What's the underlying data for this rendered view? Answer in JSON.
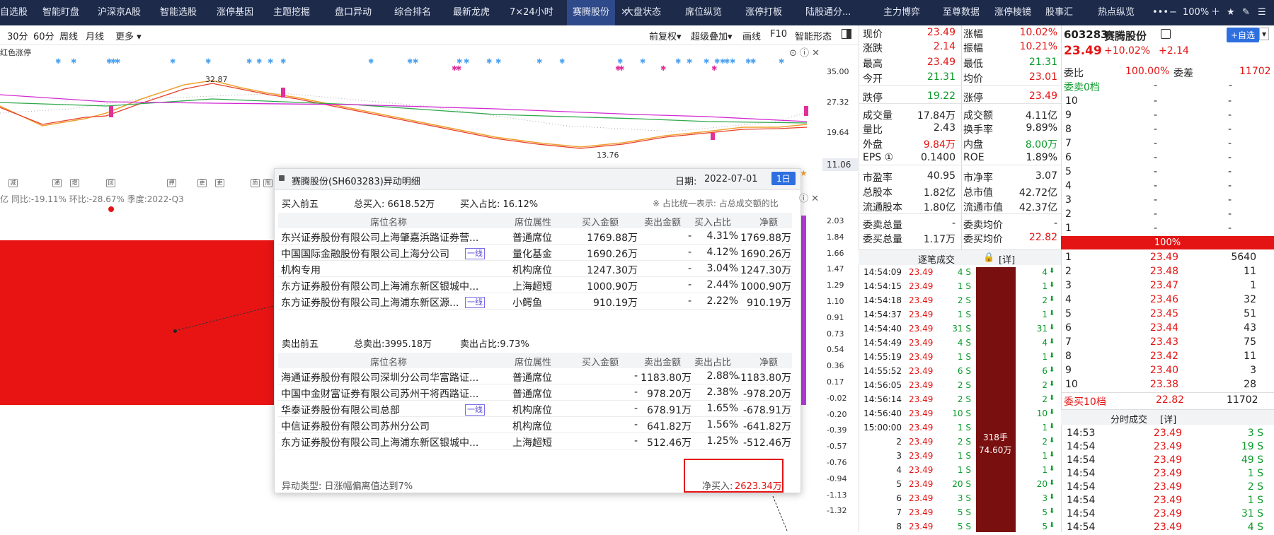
{
  "top_tabs": [
    "自选股",
    "智能盯盘",
    "沪深京A股",
    "智能选股",
    "涨停基因",
    "主题挖掘",
    "盘口异动",
    "综合排名",
    "最新龙虎",
    "7×24小时",
    "赛腾股份",
    "大盘状态",
    "席位纵览",
    "涨停打板",
    "陆股通分...",
    "主力博弈",
    "至尊数据",
    "涨停棱镜",
    "股事汇",
    "热点纵览"
  ],
  "zoom": "100%",
  "toolbar_left": [
    "30分",
    "60分",
    "周线",
    "月线",
    "更多"
  ],
  "toolbar_right": [
    "前复权",
    "超级叠加",
    "画线",
    "F10",
    "智能形态"
  ],
  "chart": {
    "legend_label": "红色涨停",
    "axis_labels": [
      "35.00",
      "27.32",
      "19.64",
      "11.06"
    ],
    "high_label": "32.87",
    "low_label": "13.76",
    "sub_axis": [
      "2.03",
      "1.84",
      "1.66",
      "1.47",
      "1.29",
      "1.10",
      "0.91",
      "0.73",
      "0.54",
      "0.36",
      "0.17",
      "-0.02",
      "-0.20",
      "-0.39",
      "-0.57",
      "-0.76",
      "-0.94",
      "-1.13",
      "-1.32"
    ],
    "finance_bar": "亿  同比:-19.11%  环比:-28.67%  季度:2022-Q3",
    "markers": [
      "减",
      "通",
      "增",
      "回",
      "押",
      "更",
      "更",
      "质",
      "周"
    ]
  },
  "popup": {
    "title": "赛腾股份(SH603283)异动明细",
    "date_label": "日期:",
    "date": "2022-07-01",
    "day_button": "1日",
    "buy": {
      "heading": "买入前五",
      "total": "总买入: 6618.52万",
      "ratio": "买入占比: 16.12%"
    },
    "note": "※ 占比统一表示: 占总成交额的比",
    "columns": [
      "席位名称",
      "席位属性",
      "买入金额",
      "卖出金额",
      "买入占比",
      "净额"
    ],
    "sell_columns": [
      "席位名称",
      "席位属性",
      "买入金额",
      "卖出金额",
      "卖出占比",
      "净额"
    ],
    "buy_rows": [
      {
        "name": "东兴证券股份有限公司上海肇嘉浜路证券营...",
        "tag": "",
        "attr": "普通席位",
        "buy": "1769.88万",
        "sell": "-",
        "ratio": "4.31%",
        "net": "1769.88万"
      },
      {
        "name": "中国国际金融股份有限公司上海分公司",
        "tag": "一线",
        "attr": "量化基金",
        "buy": "1690.26万",
        "sell": "-",
        "ratio": "4.12%",
        "net": "1690.26万"
      },
      {
        "name": "机构专用",
        "tag": "",
        "attr": "机构席位",
        "buy": "1247.30万",
        "sell": "-",
        "ratio": "3.04%",
        "net": "1247.30万"
      },
      {
        "name": "东方证券股份有限公司上海浦东新区银城中...",
        "tag": "",
        "attr": "上海超短",
        "buy": "1000.90万",
        "sell": "-",
        "ratio": "2.44%",
        "net": "1000.90万"
      },
      {
        "name": "东方证券股份有限公司上海浦东新区源...",
        "tag": "一线",
        "attr": "小鳄鱼",
        "buy": "910.19万",
        "sell": "-",
        "ratio": "2.22%",
        "net": "910.19万"
      }
    ],
    "sell": {
      "heading": "卖出前五",
      "total": "总卖出:3995.18万",
      "ratio": "卖出占比:9.73%"
    },
    "sell_rows": [
      {
        "name": "海通证券股份有限公司深圳分公司华富路证...",
        "tag": "",
        "attr": "普通席位",
        "buy": "-",
        "sell": "1183.80万",
        "ratio": "2.88%",
        "net": "-1183.80万"
      },
      {
        "name": "中国中金财富证券有限公司苏州干将西路证...",
        "tag": "",
        "attr": "普通席位",
        "buy": "-",
        "sell": "978.20万",
        "ratio": "2.38%",
        "net": "-978.20万"
      },
      {
        "name": "华泰证券股份有限公司总部",
        "tag": "一线",
        "attr": "机构席位",
        "buy": "-",
        "sell": "678.91万",
        "ratio": "1.65%",
        "net": "-678.91万"
      },
      {
        "name": "中信证券股份有限公司苏州分公司",
        "tag": "",
        "attr": "机构席位",
        "buy": "-",
        "sell": "641.82万",
        "ratio": "1.56%",
        "net": "-641.82万"
      },
      {
        "name": "东方证券股份有限公司上海浦东新区银城中...",
        "tag": "",
        "attr": "上海超短",
        "buy": "-",
        "sell": "512.46万",
        "ratio": "1.25%",
        "net": "-512.46万"
      }
    ],
    "type_label": "异动类型: 日涨幅偏离值达到7%",
    "net_label": "净买入:",
    "net_value": "2623.34万"
  },
  "quote": {
    "rows": [
      [
        "现价",
        "23.49",
        "red",
        "涨幅",
        "10.02%",
        "red"
      ],
      [
        "涨跌",
        "2.14",
        "red",
        "振幅",
        "10.21%",
        "red"
      ],
      [
        "最高",
        "23.49",
        "red",
        "最低",
        "21.31",
        "green"
      ],
      [
        "今开",
        "21.31",
        "green",
        "均价",
        "23.01",
        "red"
      ],
      [
        "跌停",
        "19.22",
        "green",
        "涨停",
        "23.49",
        "red"
      ],
      [
        "成交量",
        "17.84万",
        "blk",
        "成交额",
        "4.11亿",
        "blk"
      ],
      [
        "量比",
        "2.43",
        "blk",
        "换手率",
        "9.89%",
        "blk"
      ],
      [
        "外盘",
        "9.84万",
        "red",
        "内盘",
        "8.00万",
        "green"
      ],
      [
        "EPS ①",
        "0.1400",
        "blk",
        "ROE",
        "1.89%",
        "blk"
      ],
      [
        "市盈率",
        "40.95",
        "blk",
        "市净率",
        "3.07",
        "blk"
      ],
      [
        "总股本",
        "1.82亿",
        "blk",
        "总市值",
        "42.72亿",
        "blk"
      ],
      [
        "流通股本",
        "1.80亿",
        "blk",
        "流通市值",
        "42.37亿",
        "blk"
      ],
      [
        "委卖总量",
        "-",
        "blk",
        "委卖均价",
        "-",
        "blk"
      ],
      [
        "委买总量",
        "1.17万",
        "blk",
        "委买均价",
        "22.82",
        "red"
      ]
    ]
  },
  "ticks": {
    "header": "逐笔成交",
    "detail": "[详]",
    "rows": [
      [
        "14:54:09",
        "23.49",
        "4 S",
        "4"
      ],
      [
        "14:54:15",
        "23.49",
        "1 S",
        "1"
      ],
      [
        "14:54:18",
        "23.49",
        "2 S",
        "2"
      ],
      [
        "14:54:37",
        "23.49",
        "1 S",
        "1"
      ],
      [
        "14:54:40",
        "23.49",
        "31 S",
        "31"
      ],
      [
        "14:54:49",
        "23.49",
        "4 S",
        "4"
      ],
      [
        "14:55:19",
        "23.49",
        "1 S",
        "1"
      ],
      [
        "14:55:52",
        "23.49",
        "6 S",
        "6"
      ],
      [
        "14:56:05",
        "23.49",
        "2 S",
        "2"
      ],
      [
        "14:56:14",
        "23.49",
        "2 S",
        "2"
      ],
      [
        "14:56:40",
        "23.49",
        "10 S",
        "10"
      ],
      [
        "15:00:00",
        "23.49",
        "1 S",
        "1"
      ],
      [
        "2",
        "23.49",
        "2 S",
        "2"
      ],
      [
        "3",
        "23.49",
        "1 S",
        "1"
      ],
      [
        "4",
        "23.49",
        "1 S",
        "1"
      ],
      [
        "5",
        "23.49",
        "20 S",
        "20"
      ],
      [
        "6",
        "23.49",
        "3 S",
        "3"
      ],
      [
        "7",
        "23.49",
        "5 S",
        "5"
      ],
      [
        "8",
        "23.49",
        "5 S",
        "5"
      ]
    ],
    "big_hands": "318手",
    "big_amount": "74.60万"
  },
  "stock": {
    "code": "603283",
    "name": "赛腾股份",
    "add_button": "+自选",
    "price": "23.49",
    "pct": "+10.02%",
    "chg": "+2.14",
    "wb_label": "委比",
    "wb_value": "100.00%",
    "wc_label": "委差",
    "wc_value": "11702",
    "sell0": "委卖0档",
    "sell_levels": [
      "10",
      "9",
      "8",
      "7",
      "6",
      "5",
      "4",
      "3",
      "2",
      "1"
    ],
    "bar_label": "100%",
    "buy_levels": [
      [
        "1",
        "23.49",
        "5640"
      ],
      [
        "2",
        "23.48",
        "11"
      ],
      [
        "3",
        "23.47",
        "1"
      ],
      [
        "4",
        "23.46",
        "32"
      ],
      [
        "5",
        "23.45",
        "51"
      ],
      [
        "6",
        "23.44",
        "43"
      ],
      [
        "7",
        "23.43",
        "75"
      ],
      [
        "8",
        "23.42",
        "11"
      ],
      [
        "9",
        "23.40",
        "3"
      ],
      [
        "10",
        "23.38",
        "28"
      ]
    ],
    "buy10_label": "委买10档",
    "buy10_price": "22.82",
    "buy10_qty": "11702",
    "ts_header": "分时成交",
    "ts_detail": "[详]",
    "ts_rows": [
      [
        "14:53",
        "23.49",
        "3 S"
      ],
      [
        "14:54",
        "23.49",
        "19 S"
      ],
      [
        "14:54",
        "23.49",
        "49 S"
      ],
      [
        "14:54",
        "23.49",
        "1 S"
      ],
      [
        "14:54",
        "23.49",
        "2 S"
      ],
      [
        "14:54",
        "23.49",
        "1 S"
      ],
      [
        "14:54",
        "23.49",
        "31 S"
      ],
      [
        "14:54",
        "23.49",
        "4 S"
      ]
    ]
  }
}
